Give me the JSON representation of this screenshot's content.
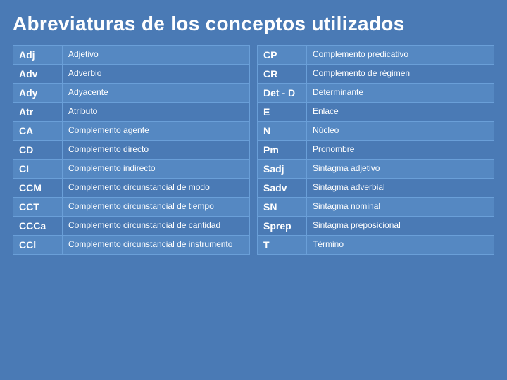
{
  "title": "Abreviaturas de los conceptos utilizados",
  "left_table": {
    "rows": [
      {
        "abbr": "Adj",
        "def": "Adjetivo"
      },
      {
        "abbr": "Adv",
        "def": "Adverbio"
      },
      {
        "abbr": "Ady",
        "def": "Adyacente"
      },
      {
        "abbr": "Atr",
        "def": "Atributo"
      },
      {
        "abbr": "CA",
        "def": "Complemento agente"
      },
      {
        "abbr": "CD",
        "def": "Complemento directo"
      },
      {
        "abbr": "CI",
        "def": "Complemento indirecto"
      },
      {
        "abbr": "CCM",
        "def": "Complemento circunstancial de modo"
      },
      {
        "abbr": "CCT",
        "def": "Complemento circunstancial de tiempo"
      },
      {
        "abbr": "CCCa",
        "def": "Complemento circunstancial de cantidad"
      },
      {
        "abbr": "CCl",
        "def": "Complemento circunstancial de instrumento"
      }
    ]
  },
  "right_table": {
    "rows": [
      {
        "abbr": "CP",
        "def": "Complemento predicativo"
      },
      {
        "abbr": "CR",
        "def": "Complemento de régimen"
      },
      {
        "abbr": "Det - D",
        "def": "Determinante"
      },
      {
        "abbr": "E",
        "def": "Enlace"
      },
      {
        "abbr": "N",
        "def": "Núcleo"
      },
      {
        "abbr": "Pm",
        "def": "Pronombre"
      },
      {
        "abbr": "Sadj",
        "def": "Sintagma adjetivo"
      },
      {
        "abbr": "Sadv",
        "def": "Sintagma adverbial"
      },
      {
        "abbr": "SN",
        "def": "Sintagma nominal"
      },
      {
        "abbr": "Sprep",
        "def": "Sintagma preposicional"
      },
      {
        "abbr": "T",
        "def": "Término"
      }
    ]
  }
}
